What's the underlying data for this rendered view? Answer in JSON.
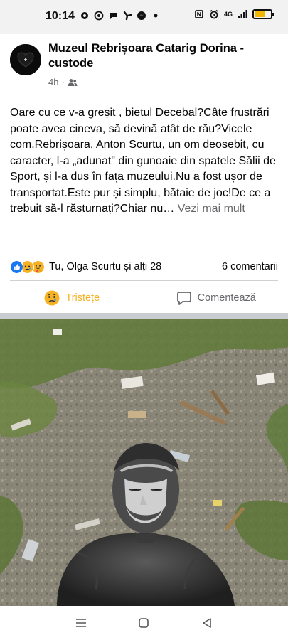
{
  "status_bar": {
    "time": "10:14",
    "network": "4G",
    "battery_level": 0.7,
    "icons_left": [
      "gear-icon",
      "whatsapp-icon",
      "chat-icon",
      "fan-icon",
      "messenger-icon",
      "dot-icon"
    ],
    "icons_right": [
      "nfc-icon",
      "alarm-icon",
      "signal-icon",
      "battery-icon"
    ]
  },
  "post": {
    "author": "Muzeul Rebrișoara Catarig Dorina - custode",
    "time": "4h",
    "audience_icon": "friends-icon",
    "text": "Oare cu ce v-a greșit , bietul Decebal?Câte frustrări poate avea cineva, să devină atât de rău?Vicele com.Rebrișoara, Anton Scurtu,  un om deosebit, cu caracter, l-a „adunat\" din gunoaie din spatele Sălii de Sport, și l-a dus în fața muzeului.Nu a fost ușor de transportat.Este pur și simplu, bătaie de joc!De ce a trebuit să-l  răsturnați?Chiar nu…",
    "see_more": " Vezi mai mult",
    "reactions": [
      "like-icon",
      "sad-icon",
      "care-icon"
    ],
    "reactors": "Tu, Olga Scurtu și alți 28",
    "comments": "6 comentarii",
    "sad_button": "Tristețe",
    "comment_button": "Comentează"
  },
  "colors": {
    "sad": "#f7b125",
    "like": "#1877f2",
    "muted": "#65676b"
  },
  "nav": [
    "menu-icon",
    "home-icon",
    "back-icon"
  ]
}
